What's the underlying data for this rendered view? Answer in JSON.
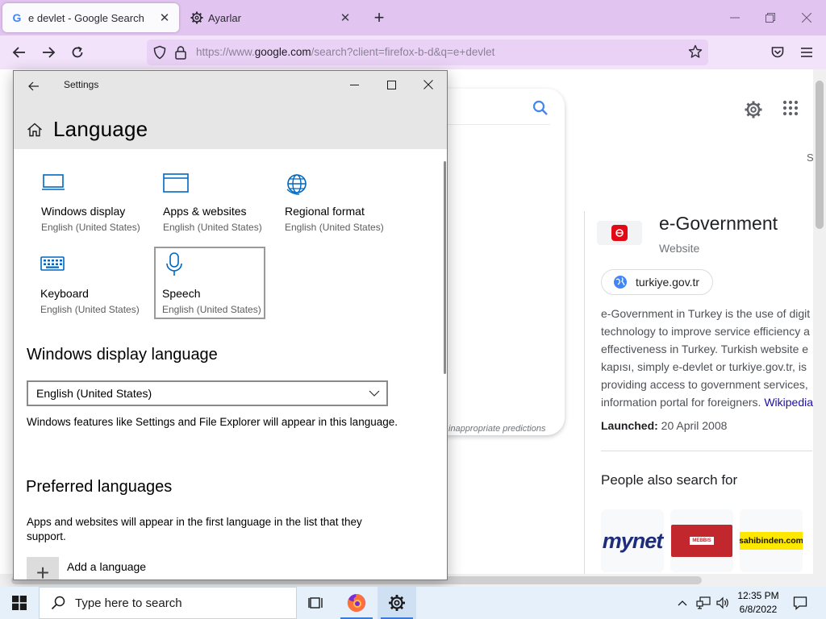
{
  "browser": {
    "tabs": [
      {
        "title": "e devlet - Google Search",
        "favicon": "G",
        "active": true
      },
      {
        "title": "Ayarlar",
        "favicon": "gear-icon",
        "active": false
      }
    ],
    "url": {
      "prefix": "https://www.",
      "domain": "google.com",
      "rest": "/search?client=firefox-b-d&q=e+devlet"
    }
  },
  "google": {
    "predictions_note": "inappropriate predictions",
    "tab_fragment": "S",
    "kp": {
      "title": "e-Government",
      "subtitle": "Website",
      "website": "turkiye.gov.tr",
      "desc_lines": [
        "e-Government in Turkey is the use of digit",
        "technology to improve service efficiency a",
        "effectiveness in Turkey. Turkish website e",
        "kapısı, simply e-devlet or turkiye.gov.tr, is",
        "providing access to government services,",
        "information portal for foreigners. "
      ],
      "wiki_link": "Wikipedia",
      "launched_label": "Launched:",
      "launched_value": " 20 April 2008",
      "pasf_heading": "People also search for",
      "pasf": [
        {
          "name": "mynet"
        },
        {
          "name": "MEBBIS"
        },
        {
          "name": "sahibinden.com"
        }
      ]
    }
  },
  "settings": {
    "window_title": "Settings",
    "heading": "Language",
    "tiles": [
      {
        "label": "Windows display",
        "sub": "English (United States)",
        "icon": "monitor-icon"
      },
      {
        "label": "Apps & websites",
        "sub": "English (United States)",
        "icon": "app-window-icon"
      },
      {
        "label": "Regional format",
        "sub": "English (United States)",
        "icon": "globe-icon"
      },
      {
        "label": "Keyboard",
        "sub": "English (United States)",
        "icon": "keyboard-icon"
      },
      {
        "label": "Speech",
        "sub": "English (United States)",
        "icon": "microphone-icon"
      }
    ],
    "display_language": {
      "heading": "Windows display language",
      "selected": "English (United States)",
      "note": "Windows features like Settings and File Explorer will appear in this language."
    },
    "preferred": {
      "heading": "Preferred languages",
      "note": "Apps and websites will appear in the first language in the list that they support.",
      "add_label": "Add a language"
    }
  },
  "taskbar": {
    "search_placeholder": "Type here to search",
    "time": "12:35 PM",
    "date": "6/8/2022"
  },
  "colors": {
    "accent": "#0067c0",
    "firefox_tabbar": "#e2c4f0",
    "firefox_navbar": "#f3e3fa",
    "taskbar": "#e5f0fb"
  }
}
